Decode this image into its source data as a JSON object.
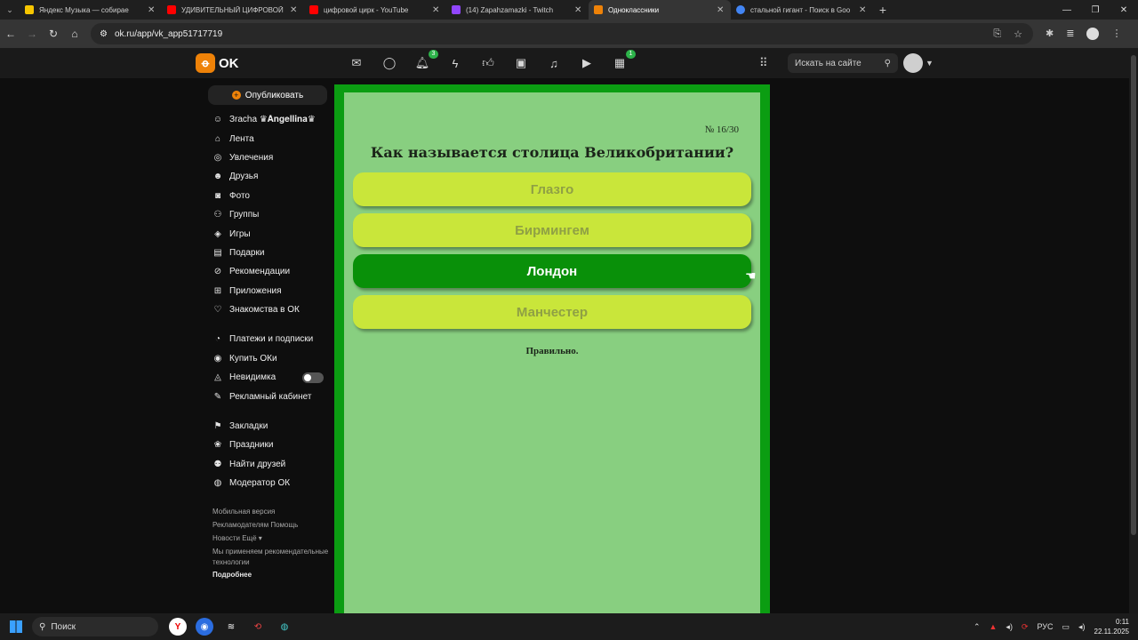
{
  "browser": {
    "tabs": [
      {
        "title": "Яндекс Музыка — собирае",
        "favicon_color": "#f7c600",
        "active": false
      },
      {
        "title": "УДИВИТЕЛЬНЫЙ ЦИФРОВОЙ",
        "favicon_color": "#ff0000",
        "active": false
      },
      {
        "title": "цифровой цирк - YouTube",
        "favicon_color": "#ff0000",
        "active": false
      },
      {
        "title": "(14) Zapahzamazki - Twitch",
        "favicon_color": "#9146ff",
        "active": false
      },
      {
        "title": "Одноклассники",
        "favicon_color": "#ee8208",
        "active": true
      },
      {
        "title": "стальной гигант - Поиск в Goo",
        "favicon_color": "#4285f4",
        "active": false
      }
    ],
    "url": "ok.ru/app/vk_app51717719"
  },
  "ok": {
    "logo_text": "OK",
    "brand_color": "#ee8208",
    "badges": {
      "notifications": "3",
      "games": "1"
    },
    "search_placeholder": "Искать на сайте"
  },
  "sidebar": {
    "publish_label": "Опубликовать",
    "profile_name": "Зracha ♛𝐀𝐧𝐠𝐞𝐥𝐥𝐢𝐧𝐚♛",
    "group1": [
      "Лента",
      "Увлечения",
      "Друзья",
      "Фото",
      "Группы",
      "Игры",
      "Подарки",
      "Рекомендации",
      "Приложения",
      "Знакомства в ОК"
    ],
    "group2": [
      "Платежи и подписки",
      "Купить ОКи",
      "Невидимка",
      "Рекламный кабинет"
    ],
    "group3": [
      "Закладки",
      "Праздники",
      "Найти друзей",
      "Модератор ОК"
    ],
    "footer": {
      "mobile": "Мобильная версия",
      "advertisers": "Рекламодателям",
      "help": "Помощь",
      "news": "Новости",
      "more": "Ещё ▾",
      "recs": "Мы применяем рекомендательные технологии",
      "details": "Подробнее"
    }
  },
  "quiz": {
    "counter": "№ 16/30",
    "question": "Как называется столица Великобритании?",
    "answers": [
      "Глазго",
      "Бирмингем",
      "Лондон",
      "Манчестер"
    ],
    "selected_index": 2,
    "result": "Правильно.",
    "colors": {
      "frame": "#0b9d12",
      "panel": "#88cf80",
      "answer": "#c9e63a",
      "selected": "#099009"
    }
  },
  "taskbar": {
    "search_label": "Поиск",
    "lang": "РУС",
    "time": "0:11",
    "date": "22.11.2025"
  }
}
